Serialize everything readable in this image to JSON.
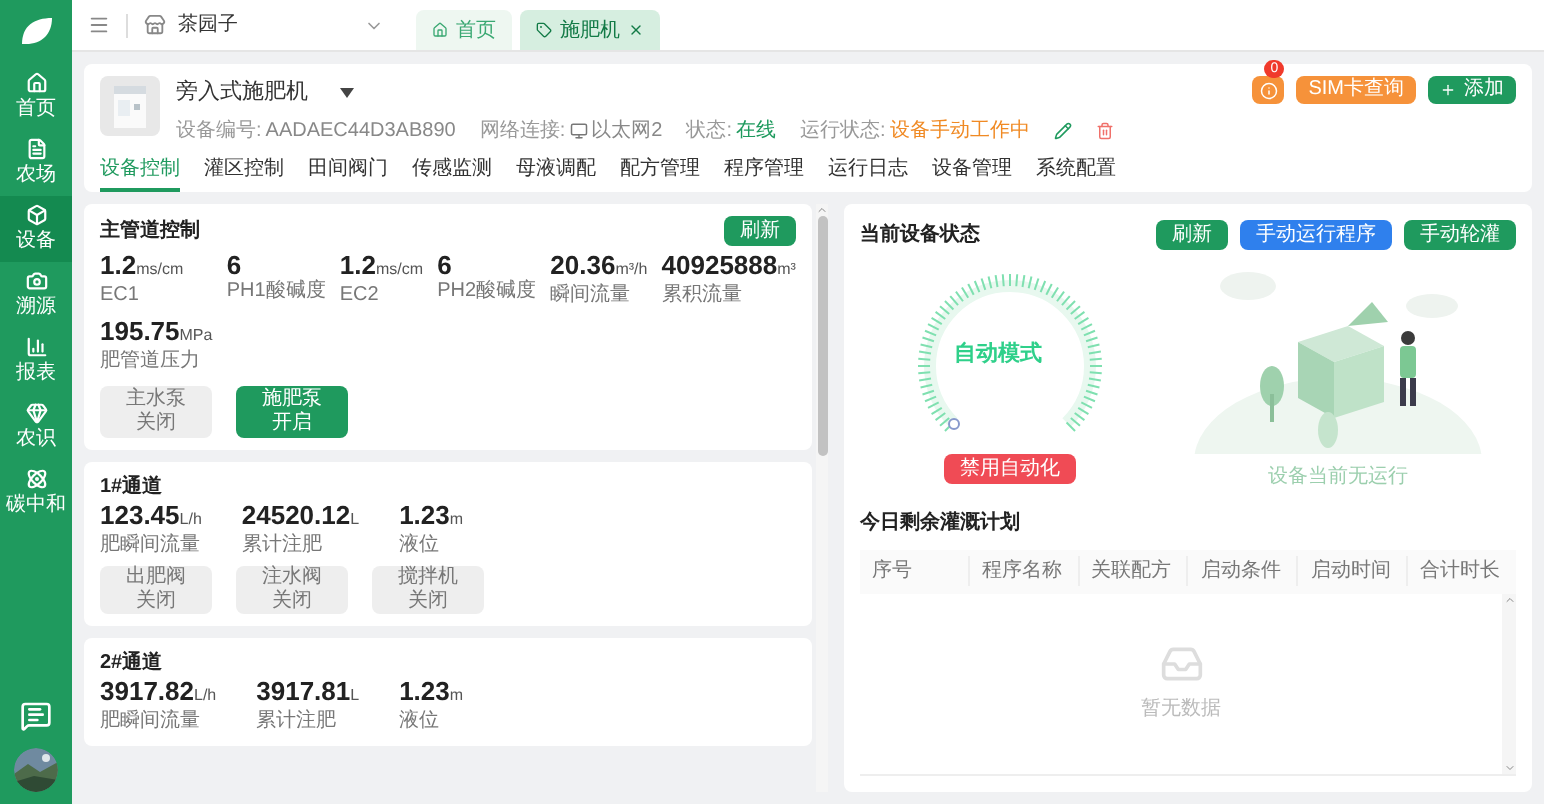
{
  "sidebar": {
    "items": [
      {
        "label": "首页",
        "selected": false
      },
      {
        "label": "农场",
        "selected": false
      },
      {
        "label": "设备",
        "selected": true
      },
      {
        "label": "溯源",
        "selected": false
      },
      {
        "label": "报表",
        "selected": false
      },
      {
        "label": "农识",
        "selected": false
      },
      {
        "label": "碳中和",
        "selected": false
      }
    ]
  },
  "topbar": {
    "farm": "茶园子",
    "tabs": [
      {
        "label": "首页",
        "selected": false,
        "closable": false
      },
      {
        "label": "施肥机",
        "selected": true,
        "closable": true
      }
    ]
  },
  "device": {
    "name": "旁入式施肥机",
    "info": [
      {
        "kind": "plain",
        "label": "设备编号:",
        "value": "AADAEC44D3AB890"
      },
      {
        "kind": "network",
        "label": "网络连接:",
        "value": "以太网2"
      },
      {
        "kind": "status",
        "label": "状态:",
        "value": "在线"
      },
      {
        "kind": "run",
        "label": "运行状态:",
        "value": "设备手动工作中"
      }
    ],
    "badge": "0",
    "sim_button": "SIM卡查询",
    "add_button": "添加"
  },
  "nav_tabs": [
    {
      "label": "设备控制",
      "selected": true
    },
    {
      "label": "灌区控制",
      "selected": false
    },
    {
      "label": "田间阀门",
      "selected": false
    },
    {
      "label": "传感监测",
      "selected": false
    },
    {
      "label": "母液调配",
      "selected": false
    },
    {
      "label": "配方管理",
      "selected": false
    },
    {
      "label": "程序管理",
      "selected": false
    },
    {
      "label": "运行日志",
      "selected": false
    },
    {
      "label": "设备管理",
      "selected": false
    },
    {
      "label": "系统配置",
      "selected": false
    }
  ],
  "main_pipe": {
    "title": "主管道控制",
    "refresh": "刷新",
    "metrics": [
      {
        "value": "1.2",
        "unit": "ms/cm",
        "label": "EC1"
      },
      {
        "value": "6",
        "label": "PH1酸碱度"
      },
      {
        "value": "1.2",
        "unit": "ms/cm",
        "label": "EC2"
      },
      {
        "value": "6",
        "label": "PH2酸碱度"
      },
      {
        "value": "20.36",
        "unit": "m³/h",
        "label": "瞬间流量"
      },
      {
        "value": "40925888",
        "unit": "m³",
        "label": "累积流量"
      },
      {
        "value": "195.75",
        "unit": "MPa",
        "label": "肥管道压力"
      }
    ],
    "switches": [
      {
        "name": "主水泵",
        "state": "关闭",
        "on": false
      },
      {
        "name": "施肥泵",
        "state": "开启",
        "on": true
      }
    ]
  },
  "channels": [
    {
      "title": "1#通道",
      "metrics": [
        {
          "value": "123.45",
          "unit": "L/h",
          "label": "肥瞬间流量"
        },
        {
          "value": "24520.12",
          "unit": "L",
          "label": "累计注肥"
        },
        {
          "value": "1.23",
          "unit": "m",
          "label": "液位"
        }
      ],
      "switches": [
        {
          "name": "出肥阀",
          "state": "关闭",
          "on": false
        },
        {
          "name": "注水阀",
          "state": "关闭",
          "on": false
        },
        {
          "name": "搅拌机",
          "state": "关闭",
          "on": false
        }
      ]
    },
    {
      "title": "2#通道",
      "metrics": [
        {
          "value": "3917.82",
          "unit": "L/h",
          "label": "肥瞬间流量"
        },
        {
          "value": "3917.81",
          "unit": "L",
          "label": "累计注肥"
        },
        {
          "value": "1.23",
          "unit": "m",
          "label": "液位"
        }
      ]
    }
  ],
  "status": {
    "title": "当前设备状态",
    "buttons": [
      {
        "label": "刷新",
        "kind": "primary"
      },
      {
        "label": "手动运行程序",
        "kind": "info"
      },
      {
        "label": "手动轮灌",
        "kind": "primary"
      }
    ],
    "mode": "自动模式",
    "disable_button": "禁用自动化",
    "idle_text": "设备当前无运行"
  },
  "plan": {
    "title": "今日剩余灌溉计划",
    "columns": [
      "序号",
      "程序名称",
      "关联配方",
      "启动条件",
      "启动时间",
      "合计时长"
    ],
    "empty_text": "暂无数据"
  }
}
